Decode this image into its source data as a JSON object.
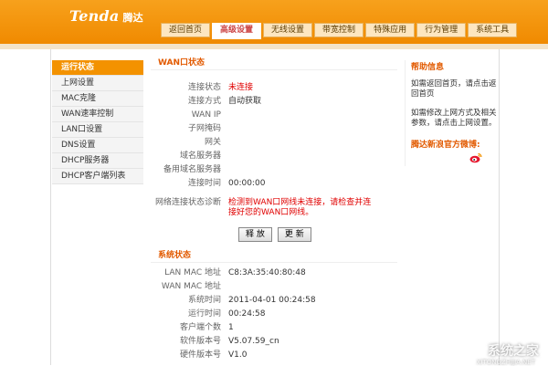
{
  "header": {
    "logo_text": "Tenda",
    "logo_cn": "腾达",
    "tabs": [
      "返回首页",
      "高级设置",
      "无线设置",
      "带宽控制",
      "特殊应用",
      "行为管理",
      "系统工具"
    ],
    "active_tab": 1
  },
  "sidebar": {
    "items": [
      "运行状态",
      "上网设置",
      "MAC克隆",
      "WAN速率控制",
      "LAN口设置",
      "DNS设置",
      "DHCP服务器",
      "DHCP客户端列表"
    ],
    "active_index": 0
  },
  "wan": {
    "title": "WAN口状态",
    "rows": [
      {
        "label": "连接状态",
        "value": "未连接"
      },
      {
        "label": "连接方式",
        "value": "自动获取"
      },
      {
        "label": "WAN IP",
        "value": ""
      },
      {
        "label": "子网掩码",
        "value": ""
      },
      {
        "label": "网关",
        "value": ""
      },
      {
        "label": "域名服务器",
        "value": ""
      },
      {
        "label": "备用域名服务器",
        "value": ""
      },
      {
        "label": "连接时间",
        "value": "00:00:00"
      }
    ],
    "diag_label": "网络连接状态诊断",
    "diag_text": "检测到WAN口网线未连接，请检查并连接好您的WAN口网线。",
    "release_button": "释 放",
    "renew_button": "更 新"
  },
  "system": {
    "title": "系统状态",
    "rows": [
      {
        "label": "LAN MAC 地址",
        "value": "C8:3A:35:40:80:48"
      },
      {
        "label": "WAN MAC 地址",
        "value": ""
      },
      {
        "label": "系统时间",
        "value": "2011-04-01 00:24:58"
      },
      {
        "label": "运行时间",
        "value": "00:24:58"
      },
      {
        "label": "客户端个数",
        "value": "1"
      },
      {
        "label": "软件版本号",
        "value": "V5.07.59_cn"
      },
      {
        "label": "硬件版本号",
        "value": "V1.0"
      }
    ]
  },
  "help": {
    "title": "帮助信息",
    "p1": "如需返回首页，请点击返回首页",
    "p2": "如需修改上网方式及相关参数，请点击上网设置。",
    "weibo": "腾达新浪官方微博:"
  },
  "watermark": {
    "text": "系统之家",
    "sub": "XITONGZHIJIA.NET"
  },
  "colors": {
    "accent": "#f39200",
    "status_red": "#e00000"
  }
}
